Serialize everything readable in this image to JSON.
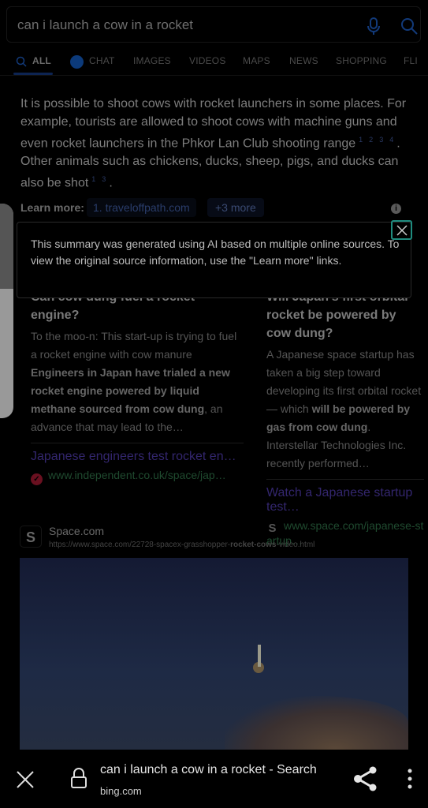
{
  "search": {
    "query": "can i launch a cow in a rocket",
    "mic_icon": "microphone-icon",
    "search_icon": "search-icon"
  },
  "tabs": [
    "ALL",
    "CHAT",
    "IMAGES",
    "VIDEOS",
    "MAPS",
    "NEWS",
    "SHOPPING",
    "FLI"
  ],
  "answer": {
    "part1": "It is possible to shoot cows with rocket launchers in some places. For example, tourists are allowed to shoot cows with machine guns and even rocket launchers in the Phkor Lan Club shooting range",
    "cites1": [
      "1",
      "2",
      "3",
      "4"
    ],
    "part2": ". Other animals such as chickens, ducks, sheep, pigs, and ducks can also be shot",
    "cites2": [
      "1",
      "3"
    ],
    "part3": "."
  },
  "learn_more": {
    "label": "Learn more:",
    "link": "1. traveloffpath.com",
    "more": "+3 more"
  },
  "popup": {
    "text": "This summary was generated using AI based on multiple online sources. To view the original source information, use the \"Learn more\" links.",
    "info_icon": "i"
  },
  "cards": [
    {
      "title": "Can cow dung fuel a rocket engine?",
      "desc1": "To the moo-n: This start-up is trying to fuel a rocket engine with cow manure ",
      "bold": "Engineers in Japan have trialed a new rocket engine powered by liquid methane sourced from cow dung",
      "desc2": ", an advance that may lead to the…",
      "link": "Japanese engineers test rocket en…",
      "url": "www.independent.co.uk/space/jap…",
      "fav": "✓"
    },
    {
      "title": "Will Japan's first orbital rocket be powered by cow dung?",
      "desc1": "A Japanese space startup has taken a big step toward developing its first orbital rocket — which ",
      "bold": "will be powered by gas from cow dung",
      "desc2": ". Interstellar Technologies Inc. recently performed…",
      "link": "Watch a Japanese startup test…",
      "url": "www.space.com/japanese-startup…",
      "fav": "S"
    }
  ],
  "result": {
    "favicon": "S",
    "site": "Space.com",
    "url_pre": "https://www.space.com/22728-spacex-grasshopper-",
    "url_bold": "rocket-cows",
    "url_post": "-video.html"
  },
  "bottom": {
    "title": "can i launch a cow in a rocket - Search",
    "domain": "bing.com",
    "close": "×"
  }
}
